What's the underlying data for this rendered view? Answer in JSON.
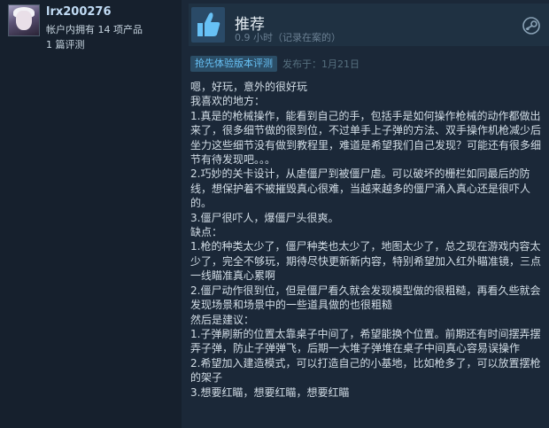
{
  "author": {
    "username": "lrx200276",
    "owned_text": "帐户内拥有 14 项产品",
    "reviews_text": "1 篇评测"
  },
  "review": {
    "verdict": "推荐",
    "hours": "0.9 小时（记录在案的）",
    "early_access_badge": "抢先体验版本评测",
    "posted": "发布于：1月21日",
    "body": [
      "嗯，好玩，意外的很好玩",
      "我喜欢的地方：",
      "1.真是的枪械操作，能看到自己的手，包括手是如何操作枪械的动作都做出来了，很多细节做的很到位，不过单手上子弹的方法、双手操作机枪减少后坐力这些细节没有做到教程里，难道是希望我们自己发现？可能还有很多细节有待发现吧。。。",
      "2.巧妙的关卡设计，从虐僵尸到被僵尸虐。可以破坏的栅栏如同最后的防线，想保护着不被摧毁真心很难，当越来越多的僵尸涌入真心还是很吓人的。",
      "3.僵尸很吓人，爆僵尸头很爽。",
      "缺点：",
      "1.枪的种类太少了，僵尸种类也太少了，地图太少了，总之现在游戏内容太少了，完全不够玩，期待尽快更新新内容，特别希望加入红外瞄准镜，三点一线瞄准真心累啊",
      "2.僵尸动作很到位，但是僵尸看久就会发现模型做的很粗糙，再看久些就会发现场景和场景中的一些道具做的也很粗糙",
      "然后是建议：",
      "1.子弹刷新的位置太靠桌子中间了，希望能换个位置。前期还有时间摆弄摆弄子弹，防止子弹弹飞，后期一大堆子弹堆在桌子中间真心容易误操作",
      "2.希望加入建造模式，可以打造自己的小基地，比如枪多了，可以放置摆枪的架子",
      "3.想要红瞄，想要红瞄，想要红瞄"
    ]
  },
  "icons": {
    "verdict": "thumbs-up-icon",
    "platform": "steam-logo-icon"
  },
  "colors": {
    "background": "#1b2838",
    "author_panel": "#16202d",
    "username": "#c1dbf4",
    "badge_text": "#67c1f5",
    "verdict_bar": "#1f3142"
  }
}
